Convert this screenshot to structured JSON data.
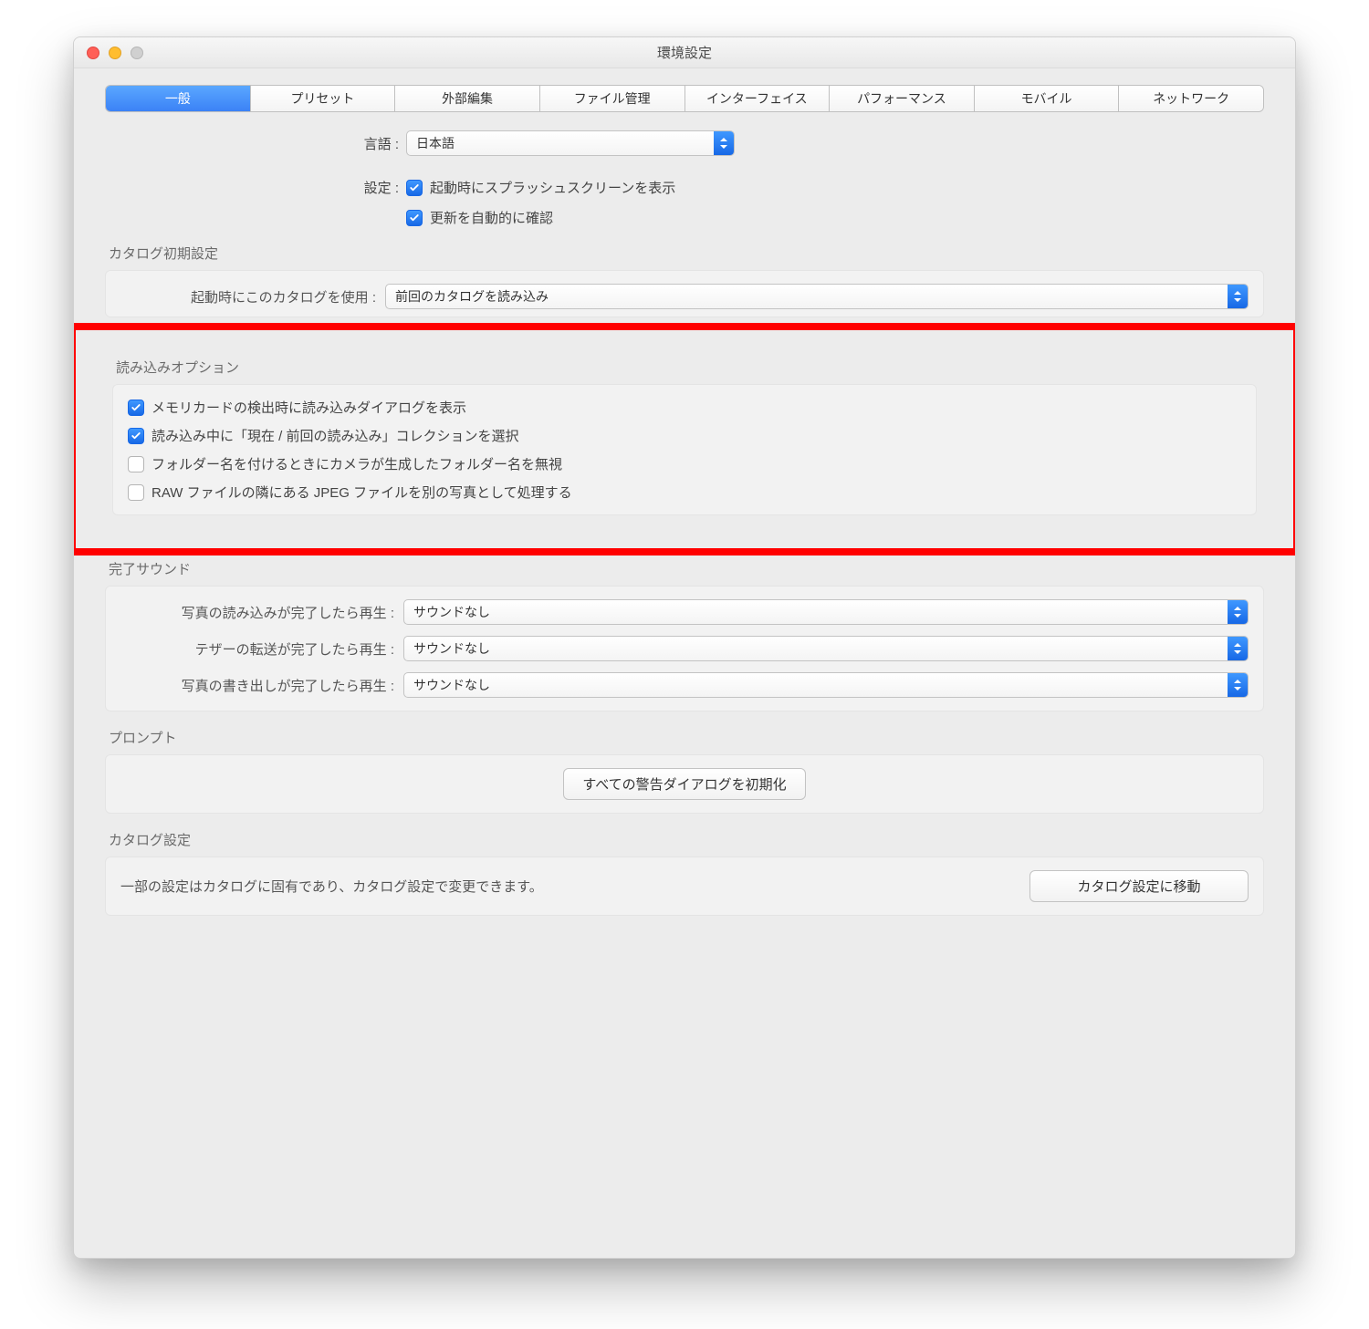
{
  "window": {
    "title": "環境設定"
  },
  "tabs": [
    "一般",
    "プリセット",
    "外部編集",
    "ファイル管理",
    "インターフェイス",
    "パフォーマンス",
    "モバイル",
    "ネットワーク"
  ],
  "active_tab": 0,
  "language": {
    "label": "言語 :",
    "value": "日本語"
  },
  "settings": {
    "label": "設定 :",
    "splash": "起動時にスプラッシュスクリーンを表示",
    "update": "更新を自動的に確認"
  },
  "catalog_init": {
    "title": "カタログ初期設定",
    "label": "起動時にこのカタログを使用 :",
    "value": "前回のカタログを読み込み"
  },
  "import_opts": {
    "title": "読み込みオプション",
    "items": [
      {
        "checked": true,
        "label": "メモリカードの検出時に読み込みダイアログを表示"
      },
      {
        "checked": true,
        "label": "読み込み中に「現在 / 前回の読み込み」コレクションを選択"
      },
      {
        "checked": false,
        "label": "フォルダー名を付けるときにカメラが生成したフォルダー名を無視"
      },
      {
        "checked": false,
        "label": "RAW ファイルの隣にある JPEG ファイルを別の写真として処理する"
      }
    ]
  },
  "sounds": {
    "title": "完了サウンド",
    "rows": [
      {
        "label": "写真の読み込みが完了したら再生 :",
        "value": "サウンドなし"
      },
      {
        "label": "テザーの転送が完了したら再生 :",
        "value": "サウンドなし"
      },
      {
        "label": "写真の書き出しが完了したら再生 :",
        "value": "サウンドなし"
      }
    ]
  },
  "prompt": {
    "title": "プロンプト",
    "button": "すべての警告ダイアログを初期化"
  },
  "catalog_settings": {
    "title": "カタログ設定",
    "text": "一部の設定はカタログに固有であり、カタログ設定で変更できます。",
    "button": "カタログ設定に移動"
  }
}
